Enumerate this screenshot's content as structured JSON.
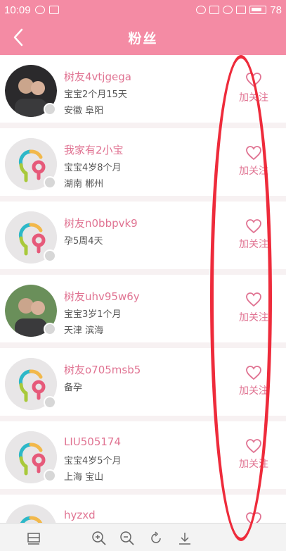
{
  "status_bar": {
    "time": "10:09",
    "battery": "78",
    "icons": [
      "shield-icon",
      "image-icon",
      "alarm-icon",
      "mute-icon",
      "wifi-icon",
      "signal-icon",
      "battery-icon"
    ]
  },
  "header": {
    "title": "粉丝",
    "back_icon": "back-arrow-icon"
  },
  "fans": [
    {
      "name": "树友4vtjgega",
      "baby": "宝宝2个月15天",
      "location": "安徽 阜阳",
      "avatar": "photo",
      "follow_label": "加关注"
    },
    {
      "name": "我家有2小宝",
      "baby": "宝宝4岁8个月",
      "location": "湖南 郴州",
      "avatar": "default",
      "follow_label": "加关注"
    },
    {
      "name": "树友n0bbpvk9",
      "baby": "孕5周4天",
      "location": "",
      "avatar": "default",
      "follow_label": "加关注"
    },
    {
      "name": "树友uhv95w6y",
      "baby": "宝宝3岁1个月",
      "location": "天津 滨海",
      "avatar": "photo",
      "follow_label": "加关注"
    },
    {
      "name": "树友o705msb5",
      "baby": "备孕",
      "location": "",
      "avatar": "default",
      "follow_label": "加关注"
    },
    {
      "name": "LIU505174",
      "baby": "宝宝4岁5个月",
      "location": "上海 宝山",
      "avatar": "default",
      "follow_label": "加关注"
    },
    {
      "name": "hyzxd",
      "baby": "",
      "location": "",
      "avatar": "default",
      "follow_label": ""
    }
  ],
  "bottom_bar": {
    "icons": [
      "layout-icon",
      "zoom-in-icon",
      "zoom-out-icon",
      "rotate-icon",
      "download-icon"
    ]
  },
  "colors": {
    "header": "#f48ba4",
    "accent": "#e07392",
    "annotation": "#ee2b3b"
  }
}
